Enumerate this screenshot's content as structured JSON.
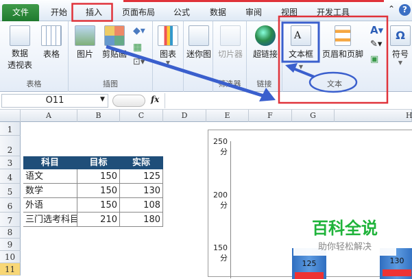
{
  "tabs": {
    "file": "文件",
    "items": [
      "开始",
      "插入",
      "页面布局",
      "公式",
      "数据",
      "审阅",
      "视图",
      "开发工具"
    ],
    "active": "插入"
  },
  "ribbon": {
    "groups": [
      {
        "label": "表格",
        "buttons": [
          "数据\n透视表",
          "表格"
        ]
      },
      {
        "label": "插图",
        "buttons": [
          "图片",
          "剪贴画"
        ]
      },
      {
        "label": "",
        "buttons": [
          "图表"
        ]
      },
      {
        "label": "",
        "buttons": [
          "迷你图"
        ]
      },
      {
        "label": "筛选器",
        "buttons": [
          "切片器"
        ]
      },
      {
        "label": "链接",
        "buttons": [
          "超链接"
        ]
      },
      {
        "label": "文本",
        "buttons": [
          "文本框",
          "页眉和页脚"
        ]
      },
      {
        "label": "",
        "buttons": [
          "符号"
        ]
      }
    ]
  },
  "formula": {
    "namebox": "O11",
    "fx": "fx"
  },
  "columns": [
    "A",
    "B",
    "C",
    "D",
    "E",
    "F",
    "G",
    "H"
  ],
  "rows": [
    "1",
    "2",
    "3",
    "4",
    "5",
    "6",
    "7",
    "8",
    "9",
    "10",
    "11"
  ],
  "table": {
    "headers": [
      "科目",
      "目标",
      "实际"
    ],
    "rows": [
      [
        "语文",
        "150",
        "125"
      ],
      [
        "数学",
        "150",
        "130"
      ],
      [
        "外语",
        "150",
        "108"
      ],
      [
        "三门选考科目",
        "210",
        "180"
      ]
    ]
  },
  "chart": {
    "ticks": [
      "250分",
      "200分",
      "150分"
    ],
    "bar_labels": [
      "125",
      "130"
    ]
  },
  "watermark": {
    "title": "百科全说",
    "subtitle": "助你轻松解决"
  },
  "colors": {
    "header": "#1f4e79",
    "annotation_red": "#e0333a",
    "annotation_blue": "#3a5fcd",
    "file_tab": "#2a8a3a"
  }
}
